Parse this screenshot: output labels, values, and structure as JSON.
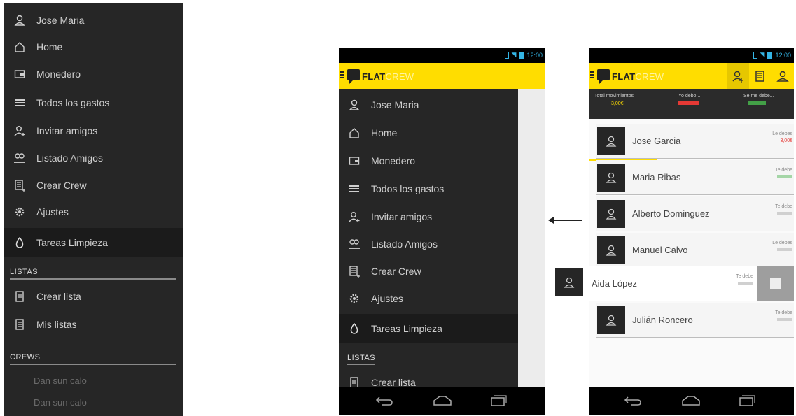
{
  "left_panel": {
    "items": [
      {
        "label": "Jose Maria",
        "icon": "user-icon"
      },
      {
        "label": "Home",
        "icon": "home-icon"
      },
      {
        "label": "Monedero",
        "icon": "wallet-icon"
      },
      {
        "label": "Todos los gastos",
        "icon": "list-icon"
      },
      {
        "label": "Invitar amigos",
        "icon": "add-user-icon"
      },
      {
        "label": "Listado Amigos",
        "icon": "friends-icon"
      },
      {
        "label": "Crear Crew",
        "icon": "building-icon"
      },
      {
        "label": "Ajustes",
        "icon": "gear-icon"
      },
      {
        "label": "Tareas Limpieza",
        "icon": "cleaning-icon"
      }
    ],
    "section_lists": "LISTAS",
    "list_items": [
      {
        "label": "Crear lista",
        "icon": "document-icon"
      },
      {
        "label": "Mis listas",
        "icon": "document-icon"
      }
    ],
    "section_crews": "CREWS",
    "crew_items": [
      "Dan sun calo",
      "Dan sun calo"
    ]
  },
  "middle_phone": {
    "status_time": "12:00",
    "logo": {
      "main": "FLAT",
      "accent": "CREW"
    },
    "drawer_items": [
      {
        "label": "Jose Maria",
        "icon": "user-icon"
      },
      {
        "label": "Home",
        "icon": "home-icon"
      },
      {
        "label": "Monedero",
        "icon": "wallet-icon"
      },
      {
        "label": "Todos los gastos",
        "icon": "list-icon"
      },
      {
        "label": "Invitar amigos",
        "icon": "add-user-icon"
      },
      {
        "label": "Listado Amigos",
        "icon": "friends-icon"
      },
      {
        "label": "Crear Crew",
        "icon": "building-icon"
      },
      {
        "label": "Ajustes",
        "icon": "gear-icon"
      },
      {
        "label": "Tareas Limpieza",
        "icon": "cleaning-icon"
      }
    ],
    "section_lists": "LISTAS",
    "list_items": [
      {
        "label": "Crear lista",
        "icon": "document-icon"
      }
    ]
  },
  "right_phone": {
    "status_time": "12:00",
    "logo": {
      "main": "FLAT",
      "accent": "CREW"
    },
    "stats": [
      {
        "label": "Total movimientos",
        "value": "3,00€"
      },
      {
        "label": "Yo debo...",
        "value": ""
      },
      {
        "label": "Se me debe...",
        "value": ""
      }
    ],
    "rows": [
      {
        "name": "Jose Garcia",
        "bal_label": "Le debes",
        "bal_value": "3,00€"
      },
      {
        "name": "Maria Ribas",
        "bal_label": "Te debe",
        "bal_value": ""
      },
      {
        "name": "Alberto Dominguez",
        "bal_label": "Te debe",
        "bal_value": ""
      },
      {
        "name": "Manuel Calvo",
        "bal_label": "Le debes",
        "bal_value": ""
      },
      {
        "name": "Aida López",
        "bal_label": "Te debe",
        "bal_value": ""
      },
      {
        "name": "Julián Roncero",
        "bal_label": "Te debe",
        "bal_value": ""
      }
    ]
  },
  "colors": {
    "accent": "#ffdd00",
    "drawer": "#262626",
    "status_blue": "#34b5e5",
    "debt_red": "#e53935",
    "credit_green": "#43a047"
  }
}
